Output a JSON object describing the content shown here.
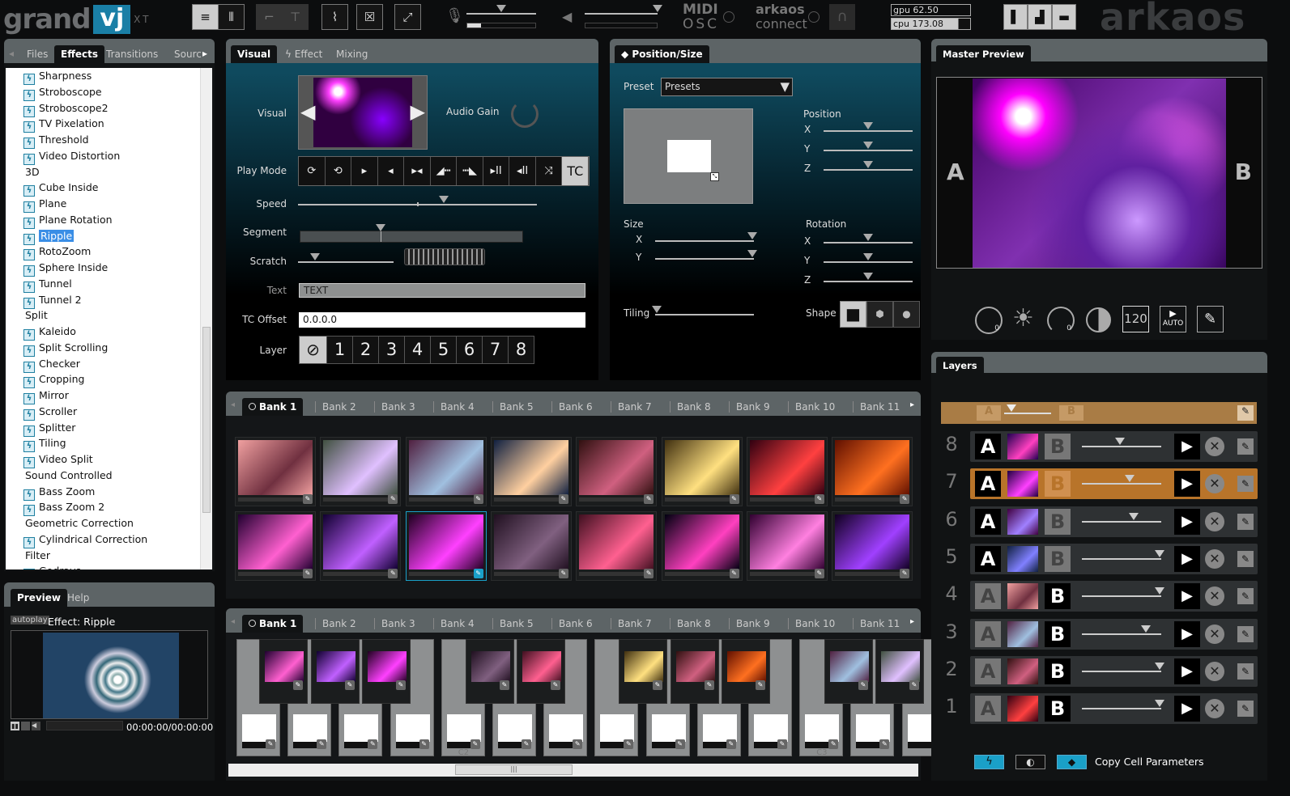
{
  "app": {
    "logo": "grand",
    "logo_vj": "vj",
    "edition": "XT",
    "brand": "arkaos"
  },
  "topbar": {
    "midi": "MIDI",
    "osc": "OSC",
    "connect_top": "arkaos",
    "connect_bottom": "connect",
    "gpu": "gpu 62.50",
    "cpu": "cpu 173.08",
    "mic_level": 0.5,
    "mic_meter": 0.2,
    "volume_level": 1.0
  },
  "left": {
    "tabs": [
      "Files",
      "Effects",
      "Transitions",
      "Sourc"
    ],
    "active_tab": "Effects",
    "items": [
      {
        "t": "item",
        "label": "Sharpness"
      },
      {
        "t": "item",
        "label": "Stroboscope"
      },
      {
        "t": "item",
        "label": "Stroboscope2"
      },
      {
        "t": "item",
        "label": "TV Pixelation"
      },
      {
        "t": "item",
        "label": "Threshold"
      },
      {
        "t": "item",
        "label": "Video Distortion"
      },
      {
        "t": "cat",
        "label": "3D"
      },
      {
        "t": "item",
        "label": "Cube Inside"
      },
      {
        "t": "item",
        "label": "Plane"
      },
      {
        "t": "item",
        "label": "Plane Rotation"
      },
      {
        "t": "item",
        "label": "Ripple",
        "selected": true
      },
      {
        "t": "item",
        "label": "RotoZoom"
      },
      {
        "t": "item",
        "label": "Sphere Inside"
      },
      {
        "t": "item",
        "label": "Tunnel"
      },
      {
        "t": "item",
        "label": "Tunnel 2"
      },
      {
        "t": "cat",
        "label": "Split"
      },
      {
        "t": "item",
        "label": "Kaleido"
      },
      {
        "t": "item",
        "label": "Split Scrolling"
      },
      {
        "t": "item",
        "label": "Checker"
      },
      {
        "t": "item",
        "label": "Cropping"
      },
      {
        "t": "item",
        "label": "Mirror"
      },
      {
        "t": "item",
        "label": "Scroller"
      },
      {
        "t": "item",
        "label": "Splitter"
      },
      {
        "t": "item",
        "label": "Tiling"
      },
      {
        "t": "item",
        "label": "Video Split"
      },
      {
        "t": "cat",
        "label": "Sound Controlled"
      },
      {
        "t": "item",
        "label": "Bass Zoom"
      },
      {
        "t": "item",
        "label": "Bass Zoom 2"
      },
      {
        "t": "cat",
        "label": "Geometric Correction"
      },
      {
        "t": "item",
        "label": "Cylindrical Correction"
      },
      {
        "t": "cat",
        "label": "Filter"
      },
      {
        "t": "item",
        "label": "Godrays"
      }
    ]
  },
  "preview": {
    "tabs": [
      "Preview",
      "Help"
    ],
    "autoplay": "autoplay",
    "title": "Effect: Ripple",
    "time": "00:00:00/00:00:00"
  },
  "visual": {
    "tabs": [
      "Visual",
      "Effect",
      "Mixing"
    ],
    "visual_label": "Visual",
    "audio_gain": "Audio Gain",
    "play_mode": "Play Mode",
    "play_buttons": [
      "loop-fwd",
      "loop-back",
      "play",
      "reverse",
      "ping-pong",
      "ramp-in",
      "ramp-out",
      "play-pause",
      "reverse-pause",
      "random",
      "TC"
    ],
    "speed": "Speed",
    "speed_value": 0.61,
    "segment": "Segment",
    "segment_value": 0.36,
    "scratch": "Scratch",
    "scratch_value": 0.18,
    "text_label": "Text",
    "text_value": "TEXT",
    "tc_label": "TC Offset",
    "tc_value": "0.0.0.0",
    "layer_label": "Layer",
    "layers": [
      "1",
      "2",
      "3",
      "4",
      "5",
      "6",
      "7",
      "8"
    ]
  },
  "position": {
    "tab": "Position/Size",
    "preset_label": "Preset",
    "preset_value": "Presets",
    "position": "Position",
    "size": "Size",
    "rotation": "Rotation",
    "tiling": "Tiling",
    "shape": "Shape",
    "x": "X",
    "y": "Y",
    "z": "Z",
    "pos_values": [
      0.5,
      0.5,
      0.5
    ],
    "size_values": [
      0.98,
      0.98
    ],
    "rot_values": [
      0.5,
      0.5,
      0.5
    ],
    "tiling_value": 0.02
  },
  "master": {
    "tab": "Master Preview",
    "a": "A",
    "b": "B",
    "knob1": "0",
    "knob2": "0",
    "bpm": "120",
    "auto": "AUTO"
  },
  "banks": {
    "tabs": [
      "Bank 1",
      "Bank 2",
      "Bank 3",
      "Bank 4",
      "Bank 5",
      "Bank 6",
      "Bank 7",
      "Bank 8",
      "Bank 9",
      "Bank 10",
      "Bank 11"
    ],
    "thumbs": [
      [
        "#f0a0a0",
        "#703040"
      ],
      [
        "#405040",
        "#e0c0ff"
      ],
      [
        "#502040",
        "#a0c0e0"
      ],
      [
        "#102040",
        "#ffd0a0"
      ],
      [
        "#301010",
        "#d06080"
      ],
      [
        "#403010",
        "#ffe080"
      ],
      [
        "#300010",
        "#ff4040"
      ],
      [
        "#601000",
        "#ff7020"
      ],
      [
        "#200030",
        "#ff60d0"
      ],
      [
        "#100030",
        "#c060ff"
      ],
      [
        "#200020",
        "#ff40ff"
      ],
      [
        "#201020",
        "#806080"
      ],
      [
        "#401020",
        "#ff6090"
      ],
      [
        "#000010",
        "#ff40c0"
      ],
      [
        "#300030",
        "#ff80e0"
      ],
      [
        "#100020",
        "#a040ff"
      ]
    ],
    "selected_cell": 10
  },
  "keyboard": {
    "c2": "C2",
    "c3": "C3"
  },
  "layers": {
    "tab": "Layers",
    "a": "A",
    "b": "B",
    "crossfade": 0.15,
    "rows": [
      {
        "n": "8",
        "a_on": true,
        "fader": 0.48,
        "thumb": [
          "#200050",
          "#ff40c0"
        ]
      },
      {
        "n": "7",
        "a_on": true,
        "fader": 0.6,
        "highlight": true,
        "thumb": [
          "#200040",
          "#ff40ff"
        ]
      },
      {
        "n": "6",
        "a_on": true,
        "fader": 0.65,
        "thumb": [
          "#400040",
          "#a080ff"
        ]
      },
      {
        "n": "5",
        "a_on": true,
        "fader": 0.98,
        "thumb": [
          "#102040",
          "#8080ff"
        ]
      },
      {
        "n": "4",
        "a_on": false,
        "fader": 0.98,
        "thumb": [
          "#f0a0a0",
          "#703040"
        ]
      },
      {
        "n": "3",
        "a_on": false,
        "fader": 0.81,
        "thumb": [
          "#502040",
          "#a0c0e0"
        ]
      },
      {
        "n": "2",
        "a_on": false,
        "fader": 0.98,
        "thumb": [
          "#301010",
          "#d06080"
        ]
      },
      {
        "n": "1",
        "a_on": false,
        "fader": 0.98,
        "thumb": [
          "#300010",
          "#ff4040"
        ]
      }
    ],
    "copy_cell": "Copy Cell Parameters"
  },
  "colors": {
    "accent": "#1aa0c8",
    "highlight": "#b8742a",
    "crossfader": "#a97c45"
  }
}
